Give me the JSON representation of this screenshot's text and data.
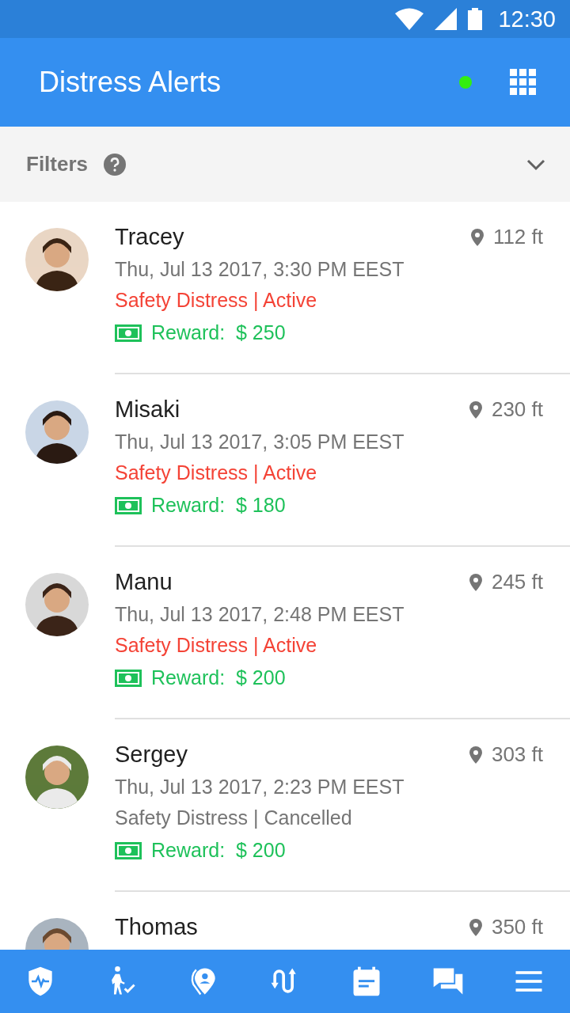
{
  "status_bar": {
    "time": "12:30"
  },
  "app_bar": {
    "title": "Distress Alerts",
    "online": true
  },
  "filters": {
    "label": "Filters",
    "expanded": false
  },
  "alerts": [
    {
      "name": "Tracey",
      "distance": "112 ft",
      "time": "Thu, Jul 13 2017, 3:30 PM EEST",
      "status": "Safety Distress | Active",
      "active": true,
      "reward_label": "Reward:",
      "reward": "$ 250"
    },
    {
      "name": "Misaki",
      "distance": "230 ft",
      "time": "Thu, Jul 13 2017, 3:05 PM EEST",
      "status": "Safety Distress | Active",
      "active": true,
      "reward_label": "Reward:",
      "reward": "$ 180"
    },
    {
      "name": "Manu",
      "distance": "245 ft",
      "time": "Thu, Jul 13 2017, 2:48 PM EEST",
      "status": "Safety Distress | Active",
      "active": true,
      "reward_label": "Reward:",
      "reward": "$ 200"
    },
    {
      "name": "Sergey",
      "distance": "303 ft",
      "time": "Thu, Jul 13 2017, 2:23 PM EEST",
      "status": "Safety Distress | Cancelled",
      "active": false,
      "reward_label": "Reward:",
      "reward": "$ 200"
    },
    {
      "name": "Thomas",
      "distance": "350 ft"
    }
  ],
  "bottom_nav": [
    {
      "kind": "shield"
    },
    {
      "kind": "walker"
    },
    {
      "kind": "pin"
    },
    {
      "kind": "route"
    },
    {
      "kind": "calendar"
    },
    {
      "kind": "chat"
    },
    {
      "kind": "menu"
    }
  ]
}
